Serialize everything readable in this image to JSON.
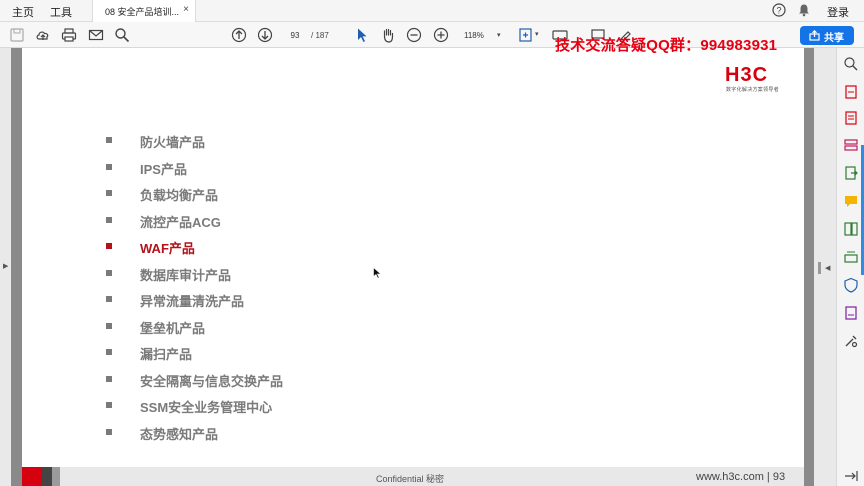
{
  "tabbar": {
    "home_label": "主页",
    "tools_label": "工具",
    "doc_tab_title": "08 安全产品培训...",
    "close_glyph": "×",
    "login_label": "登录",
    "help_icon": "help-icon",
    "bell_icon": "bell-icon"
  },
  "toolbar": {
    "page_current": "93",
    "page_total": "/ 187",
    "zoom": "118%",
    "zoom_arrow": "▾",
    "share_label": "共享",
    "watermark": "技术交流答疑QQ群：994983931"
  },
  "slide": {
    "logo_text": "H3C",
    "logo_tagline": "数字化解决方案领导者",
    "accent_color": "#b3121b",
    "items": [
      {
        "label": "防火墙产品",
        "highlight": false
      },
      {
        "label": "IPS产品",
        "highlight": false
      },
      {
        "label": "负载均衡产品",
        "highlight": false
      },
      {
        "label": "流控产品ACG",
        "highlight": false
      },
      {
        "label": "WAF产品",
        "highlight": true
      },
      {
        "label": "数据库审计产品",
        "highlight": false
      },
      {
        "label": "异常流量清洗产品",
        "highlight": false
      },
      {
        "label": "堡垒机产品",
        "highlight": false
      },
      {
        "label": "漏扫产品",
        "highlight": false
      },
      {
        "label": "安全隔离与信息交换产品",
        "highlight": false
      },
      {
        "label": "SSM安全业务管理中心",
        "highlight": false
      },
      {
        "label": "态势感知产品",
        "highlight": false
      }
    ],
    "footer_confidential": "Confidential 秘密",
    "footer_url": "www.h3c.com | 93"
  }
}
